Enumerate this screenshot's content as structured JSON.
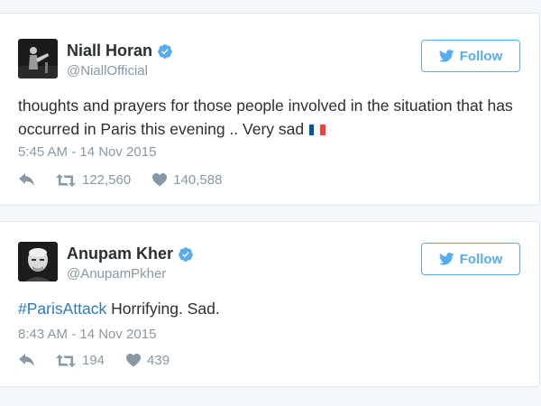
{
  "tweets": [
    {
      "name": "Niall Horan",
      "handle": "@NiallOfficial",
      "follow_label": "Follow",
      "text": "thoughts and prayers for those people involved in the situation that has occurred in Paris this evening .. Very sad",
      "flag": "french-flag",
      "timestamp": "5:45 AM - 14 Nov 2015",
      "retweets": "122,560",
      "likes": "140,588"
    },
    {
      "name": "Anupam Kher",
      "handle": "@AnupamPkher",
      "follow_label": "Follow",
      "hashtag": "#ParisAttack",
      "text": " Horrifying. Sad.",
      "timestamp": "8:43 AM - 14 Nov 2015",
      "retweets": "194",
      "likes": "439"
    }
  ],
  "colors": {
    "accent": "#55acee",
    "link": "#2b7bb9",
    "text": "#292f33",
    "muted": "#8899a6",
    "border": "#e1e8ed",
    "background": "#f5f8fa"
  },
  "icons": [
    "twitter-bird-icon",
    "verified-icon",
    "reply-icon",
    "retweet-icon",
    "heart-icon"
  ]
}
